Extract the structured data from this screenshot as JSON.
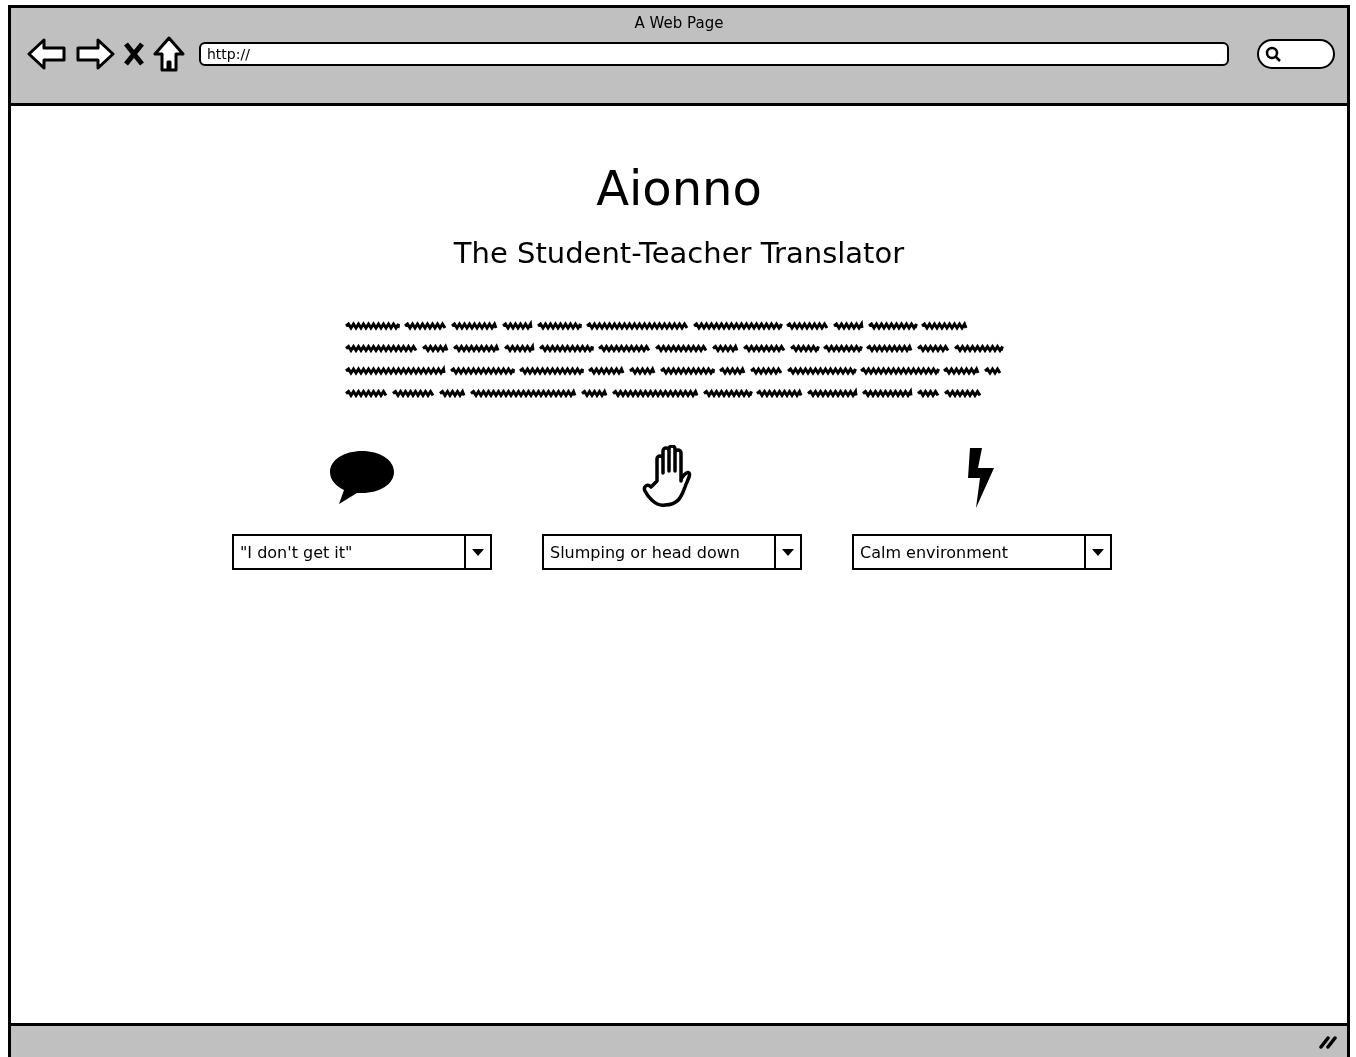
{
  "window": {
    "title": "A Web Page"
  },
  "address_bar": {
    "value": "http://"
  },
  "page": {
    "title": "Aionno",
    "subtitle": "The Student-Teacher Translator"
  },
  "columns": [
    {
      "kind": "speech",
      "dropdown": "\"I don't get it\""
    },
    {
      "kind": "hand",
      "dropdown": "Slumping or head down"
    },
    {
      "kind": "bolt",
      "dropdown": "Calm environment"
    }
  ]
}
